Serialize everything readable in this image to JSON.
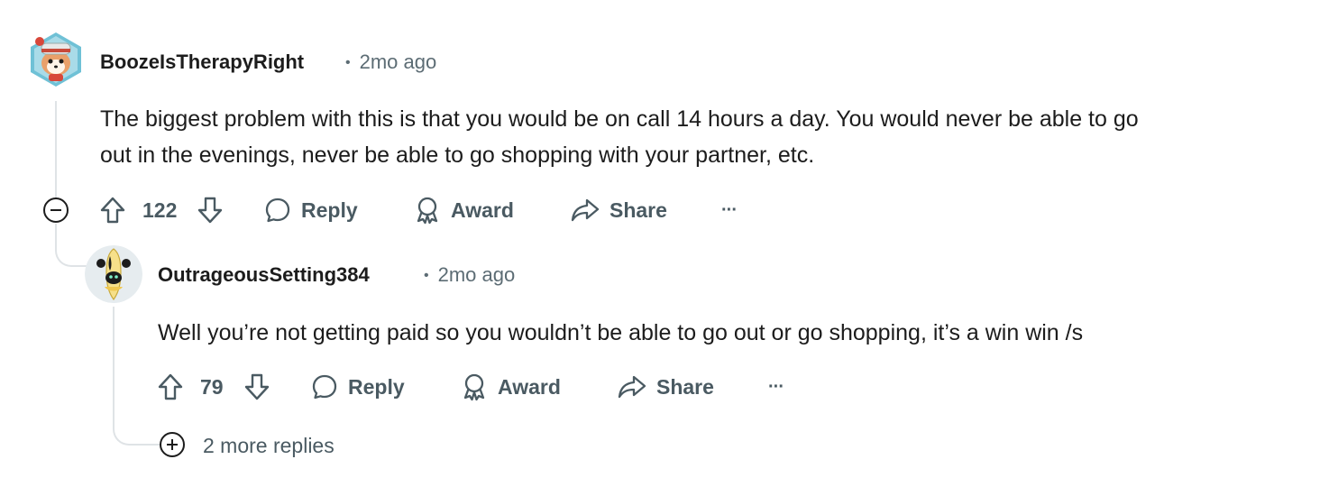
{
  "comments": [
    {
      "username": "BoozeIsTherapyRight",
      "time": "2mo ago",
      "body_line1": "The biggest problem with this is that you would be on call 14 hours a day. You would never be able to go",
      "body_line2": "out in the evenings, never be able to go shopping with your partner, etc.",
      "votes": "122",
      "reply_label": "Reply",
      "award_label": "Award",
      "share_label": "Share",
      "more_label": "···",
      "avatar_icon": "red-panda-avatar-icon"
    },
    {
      "username": "OutrageousSetting384",
      "time": "2mo ago",
      "body": "Well you’re not getting paid so you wouldn’t be able to go out or go shopping, it’s a win win /s",
      "votes": "79",
      "reply_label": "Reply",
      "award_label": "Award",
      "share_label": "Share",
      "more_label": "···",
      "avatar_icon": "banana-avatar-icon"
    }
  ],
  "more_replies": "2 more replies",
  "colors": {
    "text": "#1c1c1c",
    "meta": "#5c6c74",
    "action": "#4a5a62",
    "thread_line": "#dfe3e6"
  }
}
